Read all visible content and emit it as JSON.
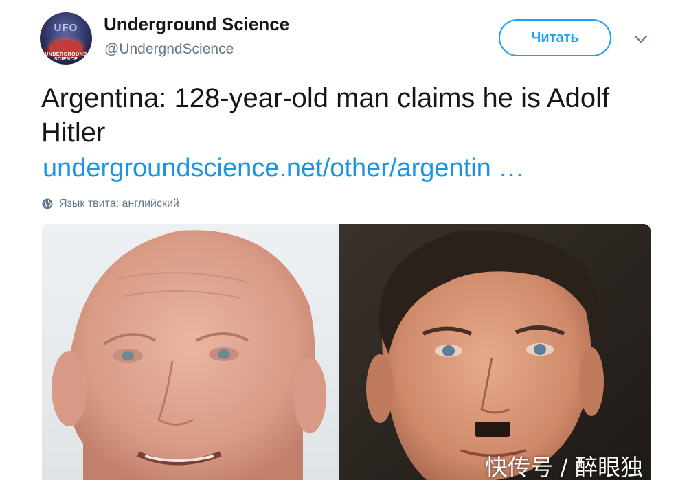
{
  "author": {
    "display_name": "Underground Science",
    "handle": "@UndergndScience",
    "avatar_label": "UFO",
    "avatar_band_text": "UNDERGROUND SCIENCE"
  },
  "follow_button": {
    "label": "Читать"
  },
  "tweet": {
    "text": "Argentina: 128-year-old man claims he is Adolf Hitler",
    "link": "undergroundscience.net/other/argentin …",
    "language_note": "Язык твита: английский"
  },
  "media": {
    "description_icons": [
      "globe-icon",
      "chevron-down-icon"
    ]
  },
  "watermark": "快传号 / 醉眼独",
  "colors": {
    "accent": "#1da1f2",
    "link": "#1b95e0",
    "muted": "#657786",
    "text": "#14171a"
  }
}
